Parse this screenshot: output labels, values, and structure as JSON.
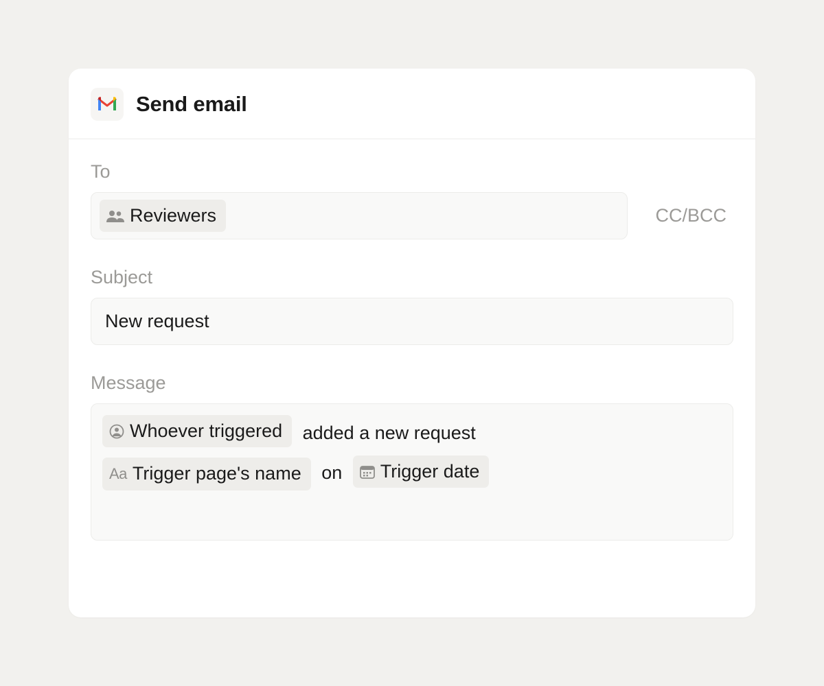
{
  "header": {
    "title": "Send email",
    "icon": "gmail-icon"
  },
  "fields": {
    "to": {
      "label": "To",
      "ccbcc": "CC/BCC",
      "chips": [
        {
          "icon": "people-icon",
          "label": "Reviewers"
        }
      ]
    },
    "subject": {
      "label": "Subject",
      "value": "New request"
    },
    "message": {
      "label": "Message",
      "tokens": [
        {
          "type": "chip",
          "icon": "person-circle-icon",
          "label": "Whoever triggered"
        },
        {
          "type": "text",
          "label": " added a new request "
        },
        {
          "type": "break"
        },
        {
          "type": "chip",
          "icon": "text-aa-icon",
          "label": "Trigger page's name"
        },
        {
          "type": "text",
          "label": " on "
        },
        {
          "type": "chip",
          "icon": "calendar-icon",
          "label": "Trigger date"
        }
      ]
    }
  }
}
